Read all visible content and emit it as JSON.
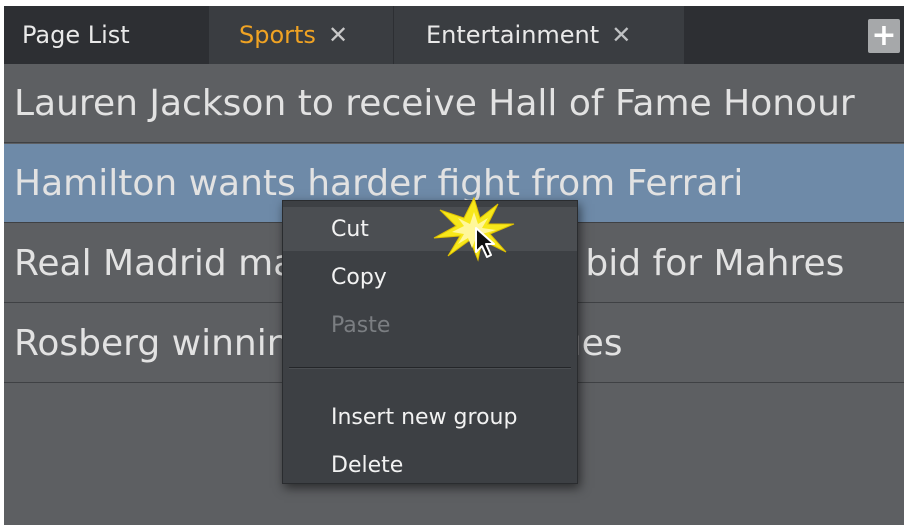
{
  "tabs": [
    {
      "label": "Page List",
      "closable": false,
      "active": false
    },
    {
      "label": "Sports",
      "closable": true,
      "active": true
    },
    {
      "label": "Entertainment",
      "closable": true,
      "active": false
    }
  ],
  "tab_close_glyph": "✕",
  "add_tab": {
    "label": "+",
    "icon": "plus-icon"
  },
  "list": {
    "items": [
      {
        "text": "Lauren Jackson to receive Hall of Fame Honour",
        "selected": false
      },
      {
        "text": "Hamilton wants harder fight from Ferrari",
        "selected": true
      },
      {
        "text": "Real Madrid make world record bid for Mahres",
        "selected": false
      },
      {
        "text": "Rosberg winning streak continues",
        "selected": false
      }
    ]
  },
  "context_menu": {
    "items": [
      {
        "label": "Cut",
        "enabled": true,
        "hovered": true
      },
      {
        "label": "Copy",
        "enabled": true
      },
      {
        "label": "Paste",
        "enabled": false
      },
      {
        "label": "Insert new group",
        "enabled": true
      },
      {
        "label": "Delete",
        "enabled": true
      }
    ]
  },
  "colors": {
    "active_tab_text": "#f0a323",
    "selected_row": "#6e8aa8",
    "background": "#5d5f62",
    "tabbar": "#2d2f33",
    "click_burst": "#f7e81b"
  },
  "icons": {
    "cursor": "arrow-cursor-icon",
    "click": "click-burst-icon"
  }
}
